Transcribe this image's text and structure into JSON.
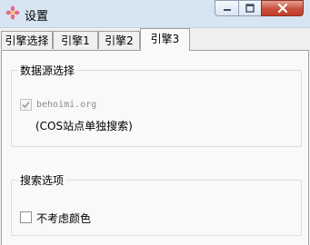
{
  "window": {
    "title": "设置",
    "app_icon": "flower-icon"
  },
  "controls": {
    "minimize": "minimize-icon",
    "maximize": "maximize-icon",
    "close": "close-icon"
  },
  "tabs": [
    {
      "label": "引擎选择",
      "active": false
    },
    {
      "label": "引擎1",
      "active": false
    },
    {
      "label": "引擎2",
      "active": false
    },
    {
      "label": "引擎3",
      "active": true
    }
  ],
  "datasource_group": {
    "title": "数据源选择",
    "checkbox": {
      "label": "behoimi.org",
      "checked": true,
      "disabled": true
    },
    "note": "(COS站点单独搜索)"
  },
  "search_options_group": {
    "title": "搜索选项",
    "checkbox": {
      "label": "不考虑颜色",
      "checked": false
    }
  }
}
